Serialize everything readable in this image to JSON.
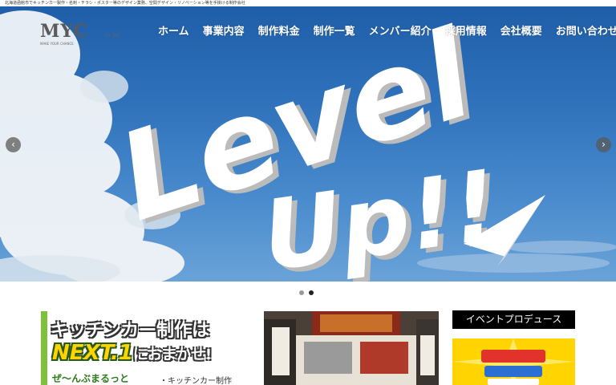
{
  "header": {
    "tagline": "北海道函館市でキッチンカー製作・名刺・チラシ・ポスター等のデザイン業務、空間デザイン・リノベーション等を手掛ける制作会社",
    "logo_text": "MYC",
    "logo_suffix": "co.,ltd.",
    "logo_subtext": "MAKE YOUR CHANCE"
  },
  "nav": {
    "items": [
      "ホーム",
      "事業内容",
      "制作料金",
      "制作一覧",
      "メンバー紹介",
      "採用情報",
      "会社概要",
      "お問い合わせ"
    ]
  },
  "hero": {
    "headline_1": "Level",
    "headline_2": "Up!!",
    "prev_icon": "chevron-left-icon",
    "next_icon": "chevron-right-icon",
    "prev_glyph": "‹",
    "next_glyph": "›",
    "slide_count": 2,
    "active_slide": 2
  },
  "banner": {
    "title_line": "キッチンカー制作は",
    "brand": "NEXT.1",
    "brand_suffix": "におまかせ!",
    "sub_line": "ぜ～んぶまるっと",
    "list_item": "・キッチンカー制作"
  },
  "sidebar": {
    "heading": "イベントプロデュース"
  },
  "colors": {
    "sky_top": "#1f5ea8",
    "banner_green": "#7ec23a",
    "brand_yellow": "#ffd400",
    "sidebar_head_bg": "#000000"
  }
}
